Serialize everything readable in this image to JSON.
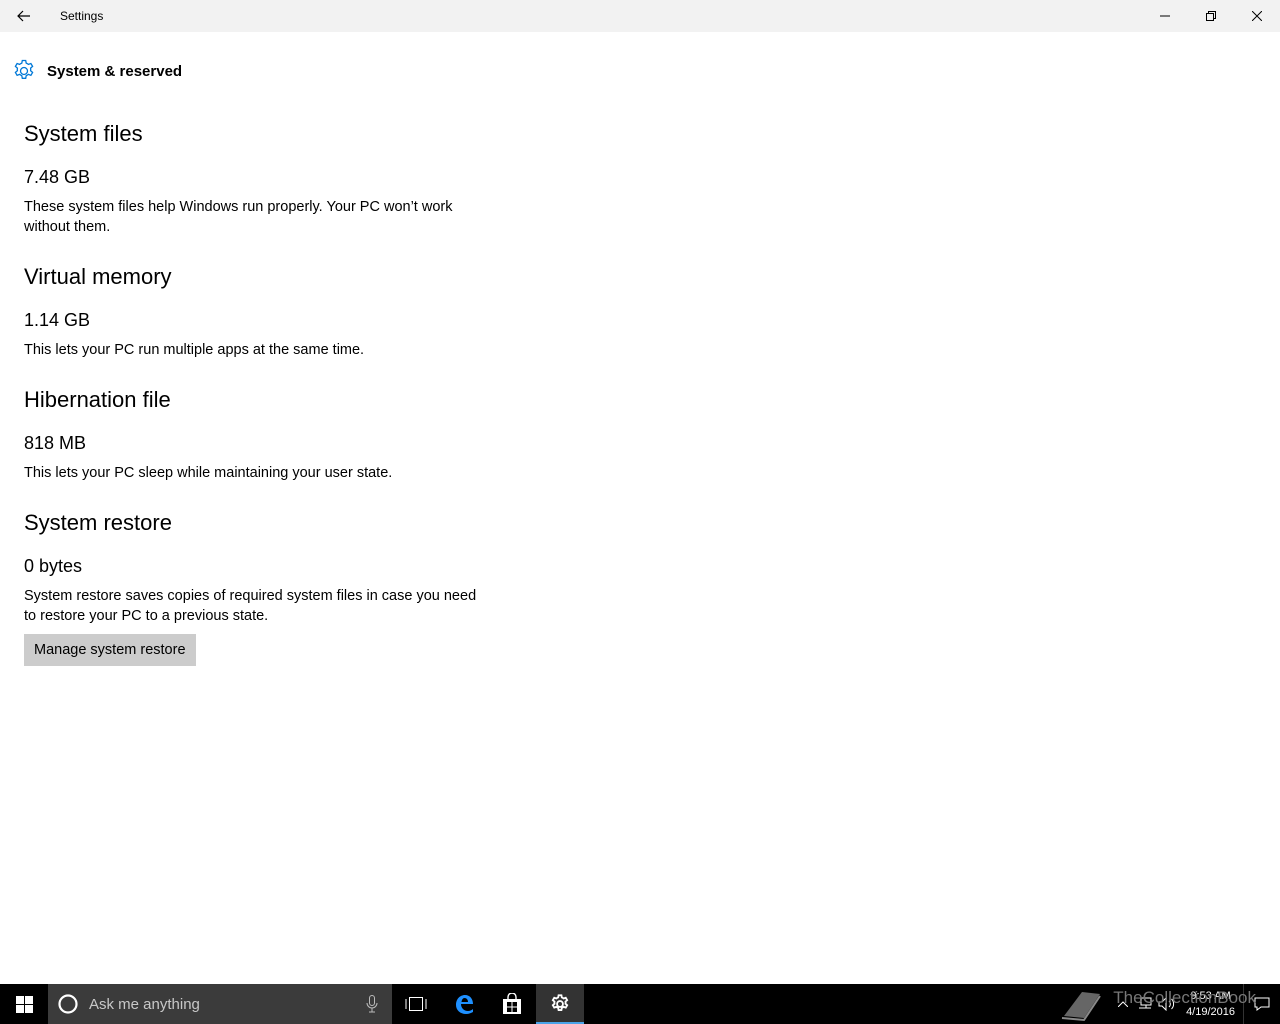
{
  "window": {
    "title": "Settings"
  },
  "page": {
    "title": "System & reserved"
  },
  "sections": [
    {
      "heading": "System files",
      "size": "7.48 GB",
      "description": "These system files help Windows run properly. Your PC won’t work without them."
    },
    {
      "heading": "Virtual memory",
      "size": "1.14 GB",
      "description": "This lets your PC run multiple apps at the same time."
    },
    {
      "heading": "Hibernation file",
      "size": "818 MB",
      "description": "This lets your PC sleep while maintaining your user state."
    },
    {
      "heading": "System restore",
      "size": "0 bytes",
      "description": "System restore saves copies of required system files in case you need to restore your PC to a previous state.",
      "button_label": "Manage system restore"
    }
  ],
  "taskbar": {
    "search_placeholder": "Ask me anything",
    "clock_time": "9:53 AM",
    "clock_date": "4/19/2016",
    "watermark": "TheCollectionBook"
  },
  "colors": {
    "accent": "#0078d7",
    "titlebar_bg": "#f2f2f2",
    "button_bg": "#cccccc",
    "taskbar_bg": "#000000",
    "search_bg": "#3b3b3b"
  }
}
